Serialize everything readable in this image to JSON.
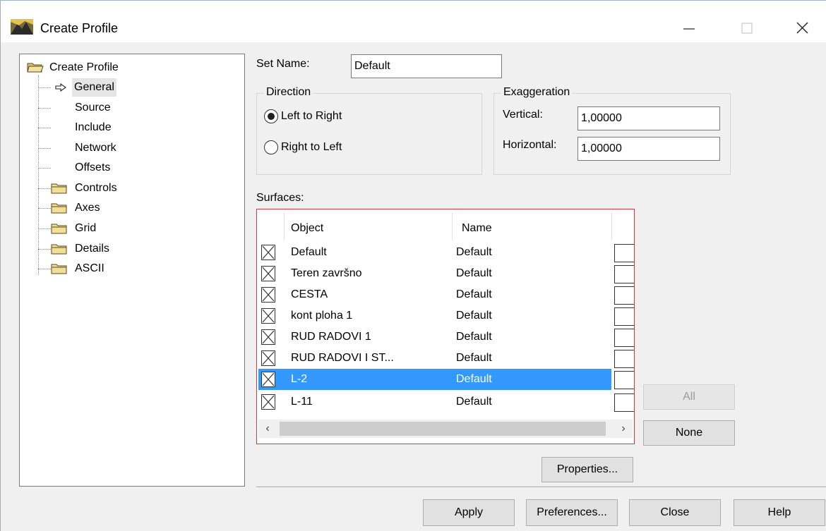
{
  "window": {
    "title": "Create Profile"
  },
  "tree": {
    "root": "Create Profile",
    "items": [
      {
        "label": "General",
        "type": "page",
        "selected": true
      },
      {
        "label": "Source",
        "type": "page"
      },
      {
        "label": "Include",
        "type": "page"
      },
      {
        "label": "Network",
        "type": "page"
      },
      {
        "label": "Offsets",
        "type": "page"
      },
      {
        "label": "Controls",
        "type": "folder"
      },
      {
        "label": "Axes",
        "type": "folder"
      },
      {
        "label": "Grid",
        "type": "folder"
      },
      {
        "label": "Details",
        "type": "folder"
      },
      {
        "label": "ASCII",
        "type": "folder"
      }
    ]
  },
  "set_name": {
    "label": "Set Name:",
    "value": "Default"
  },
  "direction": {
    "title": "Direction",
    "options": [
      {
        "label": "Left to Right",
        "checked": true
      },
      {
        "label": "Right to Left",
        "checked": false
      }
    ]
  },
  "exaggeration": {
    "title": "Exaggeration",
    "vertical_label": "Vertical:",
    "vertical_value": "1,00000",
    "horizontal_label": "Horizontal:",
    "horizontal_value": "1,00000"
  },
  "surfaces": {
    "label": "Surfaces:",
    "columns": [
      "Object",
      "Name"
    ],
    "rows": [
      {
        "object": "Default",
        "name": "Default",
        "checked": true
      },
      {
        "object": "Teren završno",
        "name": "Default",
        "checked": true
      },
      {
        "object": "CESTA",
        "name": "Default",
        "checked": true
      },
      {
        "object": "kont ploha 1",
        "name": "Default",
        "checked": true
      },
      {
        "object": "RUD RADOVI 1",
        "name": "Default",
        "checked": true
      },
      {
        "object": "RUD RADOVI I ST...",
        "name": "Default",
        "checked": true
      },
      {
        "object": "L-2",
        "name": "Default",
        "checked": true,
        "selected": true
      },
      {
        "object": "L-11",
        "name": "Default",
        "checked": true
      }
    ]
  },
  "buttons": {
    "all": "All",
    "none": "None",
    "properties": "Properties...",
    "apply": "Apply",
    "preferences": "Preferences...",
    "close": "Close",
    "help": "Help"
  },
  "colors": {
    "selection": "#3399ff",
    "surface_border": "#d23a3a",
    "dialog_bg": "#f0f0f0"
  }
}
